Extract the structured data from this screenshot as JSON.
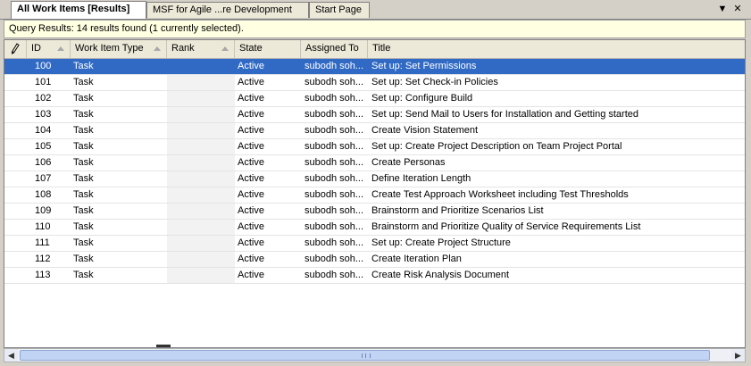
{
  "tabs": [
    {
      "label": "All Work Items [Results]",
      "active": true
    },
    {
      "label": "MSF for Agile ...re Development",
      "active": false
    },
    {
      "label": "Start Page",
      "active": false
    }
  ],
  "tab_controls": {
    "dropdown_glyph": "▼",
    "close_glyph": "✕"
  },
  "info_bar": {
    "text": "Query Results: 14 results found (1 currently selected)."
  },
  "columns": {
    "edit": "",
    "id": "ID",
    "work_item_type": "Work Item Type",
    "rank": "Rank",
    "state": "State",
    "assigned_to": "Assigned To",
    "title": "Title"
  },
  "rows": [
    {
      "id": "100",
      "type": "Task",
      "rank": "",
      "state": "Active",
      "assigned": "subodh soh...",
      "title": "Set up: Set Permissions",
      "selected": true
    },
    {
      "id": "101",
      "type": "Task",
      "rank": "",
      "state": "Active",
      "assigned": "subodh soh...",
      "title": "Set up: Set Check-in Policies",
      "selected": false
    },
    {
      "id": "102",
      "type": "Task",
      "rank": "",
      "state": "Active",
      "assigned": "subodh soh...",
      "title": "Set up: Configure Build",
      "selected": false
    },
    {
      "id": "103",
      "type": "Task",
      "rank": "",
      "state": "Active",
      "assigned": "subodh soh...",
      "title": "Set up: Send Mail to Users for Installation and Getting started",
      "selected": false
    },
    {
      "id": "104",
      "type": "Task",
      "rank": "",
      "state": "Active",
      "assigned": "subodh soh...",
      "title": "Create Vision Statement",
      "selected": false
    },
    {
      "id": "105",
      "type": "Task",
      "rank": "",
      "state": "Active",
      "assigned": "subodh soh...",
      "title": "Set up: Create Project Description on Team Project Portal",
      "selected": false
    },
    {
      "id": "106",
      "type": "Task",
      "rank": "",
      "state": "Active",
      "assigned": "subodh soh...",
      "title": "Create Personas",
      "selected": false
    },
    {
      "id": "107",
      "type": "Task",
      "rank": "",
      "state": "Active",
      "assigned": "subodh soh...",
      "title": "Define Iteration Length",
      "selected": false
    },
    {
      "id": "108",
      "type": "Task",
      "rank": "",
      "state": "Active",
      "assigned": "subodh soh...",
      "title": "Create Test Approach Worksheet including Test Thresholds",
      "selected": false
    },
    {
      "id": "109",
      "type": "Task",
      "rank": "",
      "state": "Active",
      "assigned": "subodh soh...",
      "title": "Brainstorm and Prioritize Scenarios List",
      "selected": false
    },
    {
      "id": "110",
      "type": "Task",
      "rank": "",
      "state": "Active",
      "assigned": "subodh soh...",
      "title": "Brainstorm and Prioritize Quality of Service Requirements List",
      "selected": false
    },
    {
      "id": "111",
      "type": "Task",
      "rank": "",
      "state": "Active",
      "assigned": "subodh soh...",
      "title": "Set up: Create Project Structure",
      "selected": false
    },
    {
      "id": "112",
      "type": "Task",
      "rank": "",
      "state": "Active",
      "assigned": "subodh soh...",
      "title": "Create Iteration Plan",
      "selected": false
    },
    {
      "id": "113",
      "type": "Task",
      "rank": "",
      "state": "Active",
      "assigned": "subodh soh...",
      "title": "Create Risk Analysis Document",
      "selected": false
    }
  ],
  "icons": {
    "edit_column": "pencil-icon",
    "sort": "sort-arrow-icon",
    "scroll_left": "scroll-left-arrow-icon",
    "scroll_right": "scroll-right-arrow-icon",
    "scroll_left_glyph": "◀",
    "scroll_right_glyph": "▶"
  },
  "colors": {
    "selection": "#316ac5",
    "info_bar": "#ffffe1",
    "header": "#ece9d8"
  }
}
